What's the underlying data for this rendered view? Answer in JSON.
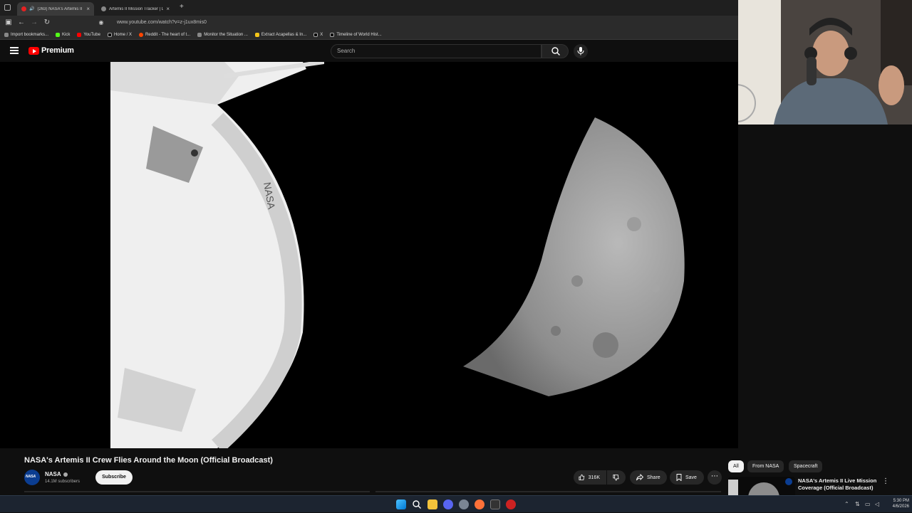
{
  "browser": {
    "tabs": [
      {
        "label": "(263) NASA's Artemis II Cre",
        "active": true
      },
      {
        "label": "Artemis II Mission Tracker | Live",
        "active": false
      }
    ],
    "new_tab_label": "+",
    "url": "www.youtube.com/watch?v=z-j1ux8mis0",
    "bookmarks": [
      "Import bookmarks...",
      "Kick",
      "YouTube",
      "Home / X",
      "Reddit - The heart of t...",
      "Monitor the Situation ...",
      "Extract Acapellas & In...",
      "X",
      "Timeline of World Hist..."
    ]
  },
  "youtube": {
    "logo_text": "Premium",
    "search_placeholder": "Search"
  },
  "video": {
    "title": "NASA's Artemis II Crew Flies Around the Moon (Official Broadcast)",
    "channel_name": "NASA",
    "channel_avatar_text": "NASA",
    "subscribers": "14.1M subscribers",
    "subscribe_label": "Subscribe",
    "like_count": "316K",
    "share_label": "Share",
    "save_label": "Save"
  },
  "sidebar": {
    "chips": [
      "All",
      "From NASA",
      "Spacecraft"
    ],
    "recommended": [
      {
        "title": "NASA's Artemis II Live Mission Coverage (Official Broadcast)"
      }
    ]
  },
  "taskbar": {
    "time": "5:30 PM",
    "date": "4/6/2026"
  },
  "colors": {
    "youtube_red": "#ff0000",
    "nasa_blue": "#0b3d91",
    "background": "#0f0f0f"
  }
}
